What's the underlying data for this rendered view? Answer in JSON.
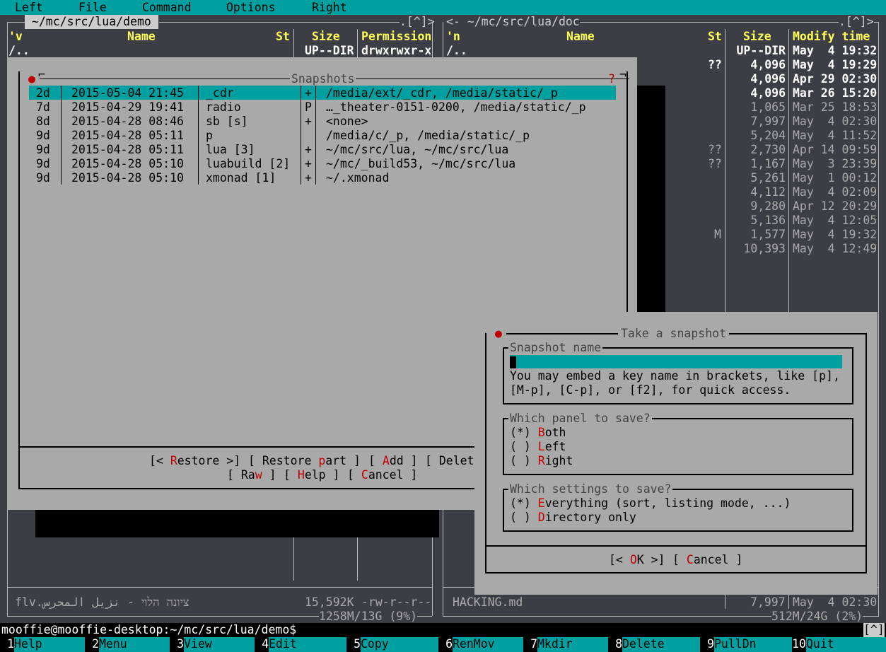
{
  "menu": {
    "left": "Left",
    "file": "File",
    "command": "Command",
    "options": "Options",
    "right": "Right"
  },
  "left_panel": {
    "path": " ~/mc/src/lua/demo ",
    "corner": ".[^]>",
    "hdr_sort": "'v",
    "hdr_name": "Name",
    "hdr_st": "St",
    "hdr_size": "Size",
    "hdr_perm": "Permission",
    "updir_name": "/..",
    "updir_size": "UP--DIR",
    "updir_perm": "drwxrwxr-x",
    "status_name": "flv.ציונה הלוי - نزيل المحرس",
    "status_size": "15,592K",
    "status_perm": "-rw-r--r--",
    "free": "1258M/13G (9%)"
  },
  "right_panel": {
    "path": "<- ~/mc/src/lua/doc",
    "corner": ".[^]>",
    "hdr_sort": "'n",
    "hdr_name": "Name",
    "hdr_st": "St",
    "hdr_size": "Size",
    "hdr_modify": "Modify time",
    "rows": [
      {
        "st": "",
        "size": "UP--DIR",
        "time": "May  4 19:32",
        "bold": true
      },
      {
        "st": "??",
        "size": "4,096",
        "time": "May  4 19:29",
        "bold": true
      },
      {
        "st": "",
        "size": "4,096",
        "time": "Apr 29 02:30",
        "bold": true
      },
      {
        "st": "",
        "size": "4,096",
        "time": "Mar 26 15:20",
        "bold": true
      },
      {
        "st": "",
        "size": "1,065",
        "time": "Mar 25 18:53",
        "bold": false
      },
      {
        "st": "",
        "size": "7,997",
        "time": "May  4 02:30",
        "bold": false
      },
      {
        "st": "",
        "size": "5,204",
        "time": "May  4 11:52",
        "bold": false
      },
      {
        "st": "??",
        "size": "2,730",
        "time": "Apr 14 09:59",
        "bold": false
      },
      {
        "st": "??",
        "size": "1,167",
        "time": "May  3 23:39",
        "bold": false
      },
      {
        "st": "",
        "size": "5,261",
        "time": "May  1 00:12",
        "bold": false
      },
      {
        "st": "",
        "size": "4,112",
        "time": "May  4 02:09",
        "bold": false
      },
      {
        "st": "",
        "size": "9,280",
        "time": "Apr 12 20:29",
        "bold": false
      },
      {
        "st": "",
        "size": "5,136",
        "time": "May  4 12:05",
        "bold": false
      },
      {
        "st": "M",
        "size": "1,577",
        "time": "May  4 19:32",
        "bold": false
      },
      {
        "st": "",
        "size": "10,393",
        "time": "May  4 12:49",
        "bold": false
      }
    ],
    "updir_name": "/..",
    "status_name": "HACKING.md",
    "status_size": "7,997",
    "status_time": "May  4 02:30",
    "free": "512M/24G (2%)"
  },
  "snapshots": {
    "title": "Snapshots",
    "help_mark": "?",
    "rows": [
      {
        "age": "2d",
        "date": "2015-05-04 21:45",
        "name": "_cdr",
        "flag": "+",
        "paths": "/media/ext/_cdr, /media/static/_p"
      },
      {
        "age": "7d",
        "date": "2015-04-29 19:41",
        "name": "radio",
        "flag": "P",
        "paths": "…_theater-0151-0200, /media/static/_p"
      },
      {
        "age": "8d",
        "date": "2015-04-28 08:46",
        "name": "sb [s]",
        "flag": "+",
        "paths": "<none>"
      },
      {
        "age": "9d",
        "date": "2015-04-28 05:11",
        "name": "p",
        "flag": "",
        "paths": "/media/c/_p, /media/static/_p"
      },
      {
        "age": "9d",
        "date": "2015-04-28 05:11",
        "name": "lua [3]",
        "flag": "+",
        "paths": "~/mc/src/lua, ~/mc/src/lua"
      },
      {
        "age": "9d",
        "date": "2015-04-28 05:10",
        "name": "luabuild [2]",
        "flag": "+",
        "paths": "~/mc/_build53, ~/mc/src/lua"
      },
      {
        "age": "9d",
        "date": "2015-04-28 05:10",
        "name": "xmonad [1]",
        "flag": "+",
        "paths": "~/.xmonad"
      }
    ],
    "btn_restore": {
      "pre": "[< ",
      "hot": "R",
      "post": "estore >]"
    },
    "btn_restore_part": {
      "pre": "[ Restore ",
      "hot": "p",
      "post": "art ]"
    },
    "btn_add": {
      "pre": "[ ",
      "hot": "A",
      "post": "dd ]"
    },
    "btn_delete": {
      "pre": "[ Delet",
      "hot": "",
      "post": ""
    },
    "btn_raw": {
      "pre": "[ Ra",
      "hot": "w",
      "post": " ]"
    },
    "btn_help": {
      "pre": "[ ",
      "hot": "H",
      "post": "elp ]"
    },
    "btn_cancel": {
      "pre": "[ ",
      "hot": "C",
      "post": "ancel ]"
    }
  },
  "take": {
    "title": "Take a snapshot",
    "name_label": "Snapshot name",
    "name_value": "",
    "hint1": "You may embed a key name in brackets, like [p],",
    "hint2": "[M-p], [C-p], or [f2], for quick access.",
    "panel_label": "Which panel to save?",
    "panel_opts": [
      {
        "mark": "(*) ",
        "hot": "B",
        "rest": "oth"
      },
      {
        "mark": "( ) ",
        "hot": "L",
        "rest": "eft"
      },
      {
        "mark": "( ) ",
        "hot": "R",
        "rest": "ight"
      }
    ],
    "settings_label": "Which settings to save?",
    "settings_opts": [
      {
        "mark": "(*) ",
        "hot": "E",
        "rest": "verything (sort, listing mode, ...)"
      },
      {
        "mark": "( ) ",
        "hot": "D",
        "rest": "irectory only"
      }
    ],
    "ok": {
      "pre": "[< ",
      "hot": "O",
      "post": "K >]"
    },
    "cancel": {
      "pre": "[ ",
      "hot": "C",
      "post": "ancel ]"
    }
  },
  "cmdline": {
    "prompt": "mooffie@mooffie-desktop:~/mc/src/lua/demo$",
    "corner": "[^]"
  },
  "fkeys": [
    {
      "n": "1",
      "label": "Help"
    },
    {
      "n": "2",
      "label": "Menu"
    },
    {
      "n": "3",
      "label": "View"
    },
    {
      "n": "4",
      "label": "Edit"
    },
    {
      "n": "5",
      "label": "Copy"
    },
    {
      "n": "6",
      "label": "RenMov"
    },
    {
      "n": "7",
      "label": "Mkdir"
    },
    {
      "n": "8",
      "label": "Delete"
    },
    {
      "n": "9",
      "label": "PullDn"
    },
    {
      "n": "10",
      "label": "Quit"
    }
  ]
}
